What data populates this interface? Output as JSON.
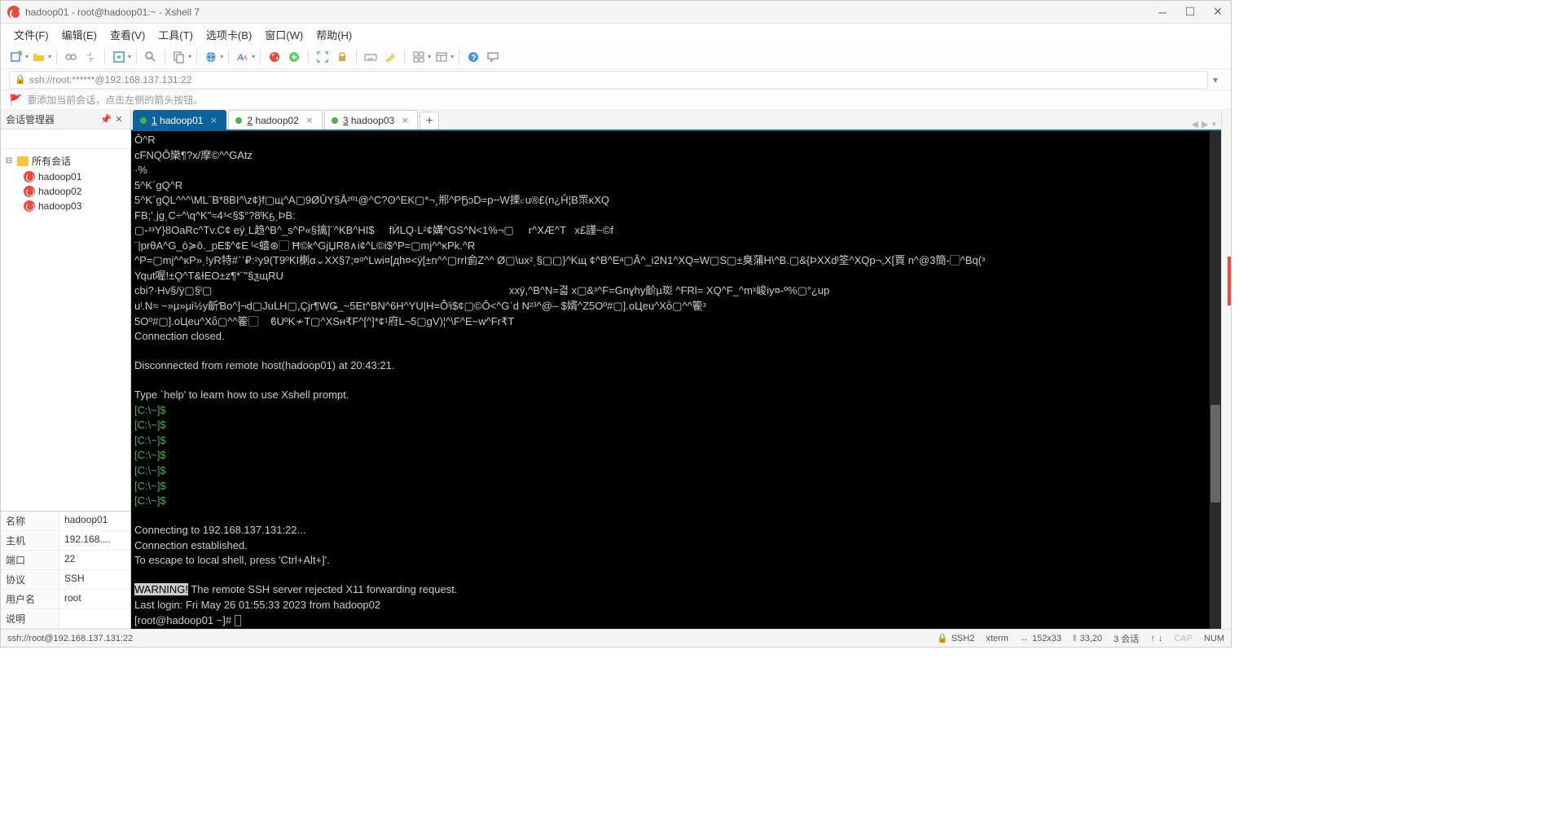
{
  "titlebar": {
    "text": "hadoop01 - root@hadoop01:~ - Xshell 7"
  },
  "menubar": {
    "items": [
      {
        "label": "文件(F)"
      },
      {
        "label": "编辑(E)"
      },
      {
        "label": "查看(V)"
      },
      {
        "label": "工具(T)"
      },
      {
        "label": "选项卡(B)"
      },
      {
        "label": "窗口(W)"
      },
      {
        "label": "帮助(H)"
      }
    ]
  },
  "addressbar": {
    "url": "ssh://root:******@192.168.137.131:22"
  },
  "tipbar": {
    "text": "要添加当前会话，点击左侧的箭头按钮。"
  },
  "session_panel": {
    "title": "会话管理器",
    "root": "所有会话",
    "sessions": [
      {
        "name": "hadoop01"
      },
      {
        "name": "hadoop02"
      },
      {
        "name": "hadoop03"
      }
    ]
  },
  "properties": {
    "rows": [
      {
        "label": "名称",
        "value": "hadoop01"
      },
      {
        "label": "主机",
        "value": "192.168...."
      },
      {
        "label": "端口",
        "value": "22"
      },
      {
        "label": "协议",
        "value": "SSH"
      },
      {
        "label": "用户名",
        "value": "root"
      },
      {
        "label": "说明",
        "value": ""
      }
    ]
  },
  "tabs": [
    {
      "num": "1",
      "label": "hadoop01",
      "active": true
    },
    {
      "num": "2",
      "label": "hadoop02",
      "active": false
    },
    {
      "num": "3",
      "label": "hadoop03",
      "active": false
    }
  ],
  "terminal": {
    "garbage": "Ô^R\ncFNQÔ欒¶?x/摩©^^GAtz\n·%\n5^K´gQ^R\n5^K´gQL^^^\\ML¨B*8BI^\\z¢}f▢щ^A▢9ØÛY§Å²º¹@^C?ʘ^EK▢*¬¸郱^PҔɔD=p╌W搮⟔u®£(n¿Ĥ¦B眔ĸXQ\nFB;'ˎjgˎC÷^\\q^K\"≈4ᵌ<§$°?8ˡKҕˎÞB:\n▢-ᵌᵌY}8OaRc^Tv.C¢ eÿˎL趋^B^_s^P«§擒]¨^KB^HI$     fЍLQ·L²¢媾^GS^N<1%¬▢     r^XÆ^T   x£謹~©f\n¨|prθA^G_ò≽ô._pE$^¢E ˡ<蟢⊛▢ Ħ©k^GjЏR8∧i¢^L©i$^P=▢mj^^ĸPk.^R\n^P=▢mj^^ĸP»ˎ!yR特#`ˋ₽:²y9(T9ºKI楋α⌄XX§7;¤ᵅ^Lwi¤[дh¤<ÿ[±n^^▢rrI侴Z^^ Ø▢\\ux²ˎ§▢▢}^Kщ ¢^B^Eᵃ▢Â^_i2N1^XQ=W▢S▢±臭蒲H\\^B.▢&{ÞXXdˡ筌^XQp¬,X[賈 n^@3簡-▢^Bq(ᵌ\nYqut喔!±O̥^T&ƗEO±z¶*¨\"§ƺщRU\ncbi?·Hv§/ÿ▢§ˡ▢                                                                                                     xxÿ,^B^N=겳 x▢&ᵌ^F=Gnɣhy齘µ珳 ^FRl= XQ^F_^mˣ峻iy¤-º%▢°¿up\nuˡ.N≈ ~»μ»μi½y齗Ɓo^]¬d▢JuⅬH▢,Çjr¶WǤ_~5Et^BN^6H^YU|H=Ȭˡi$¢▢©Ô<^Gˋd N²³^@– $婿^Z5Oº#▢].oЦeu^Xȫ▢^^篧ᵌ\n5Oº#▢].oЦeu^Xȫ▢^^篧▢    ϐUºK≁T▢^XSн₹F^[^]*¢¹府L¬5▢gV)¦^\\F^E~w^Fr₹T",
    "connection_closed": "Connection closed.",
    "disconnected": "Disconnected from remote host(hadoop01) at 20:43:21.",
    "type_help": "Type `help' to learn how to use Xshell prompt.",
    "prompt": "[C:\\~]$",
    "connecting": "Connecting to 192.168.137.131:22...",
    "established": "Connection established.",
    "escape": "To escape to local shell, press 'Ctrl+Alt+]'.",
    "warning_label": "WARNING!",
    "warning_text": " The remote SSH server rejected X11 forwarding request.",
    "last_login": "Last login: Fri May 26 01:55:33 2023 from hadoop02",
    "shell_prompt": "[root@hadoop01 ~]# "
  },
  "statusbar": {
    "left": "ssh://root@192.168.137.131:22",
    "proto": "SSH2",
    "term": "xterm",
    "size": "152x33",
    "cursor": "33,20",
    "sessions": "3 会话",
    "cap": "CAP",
    "num": "NUM"
  }
}
